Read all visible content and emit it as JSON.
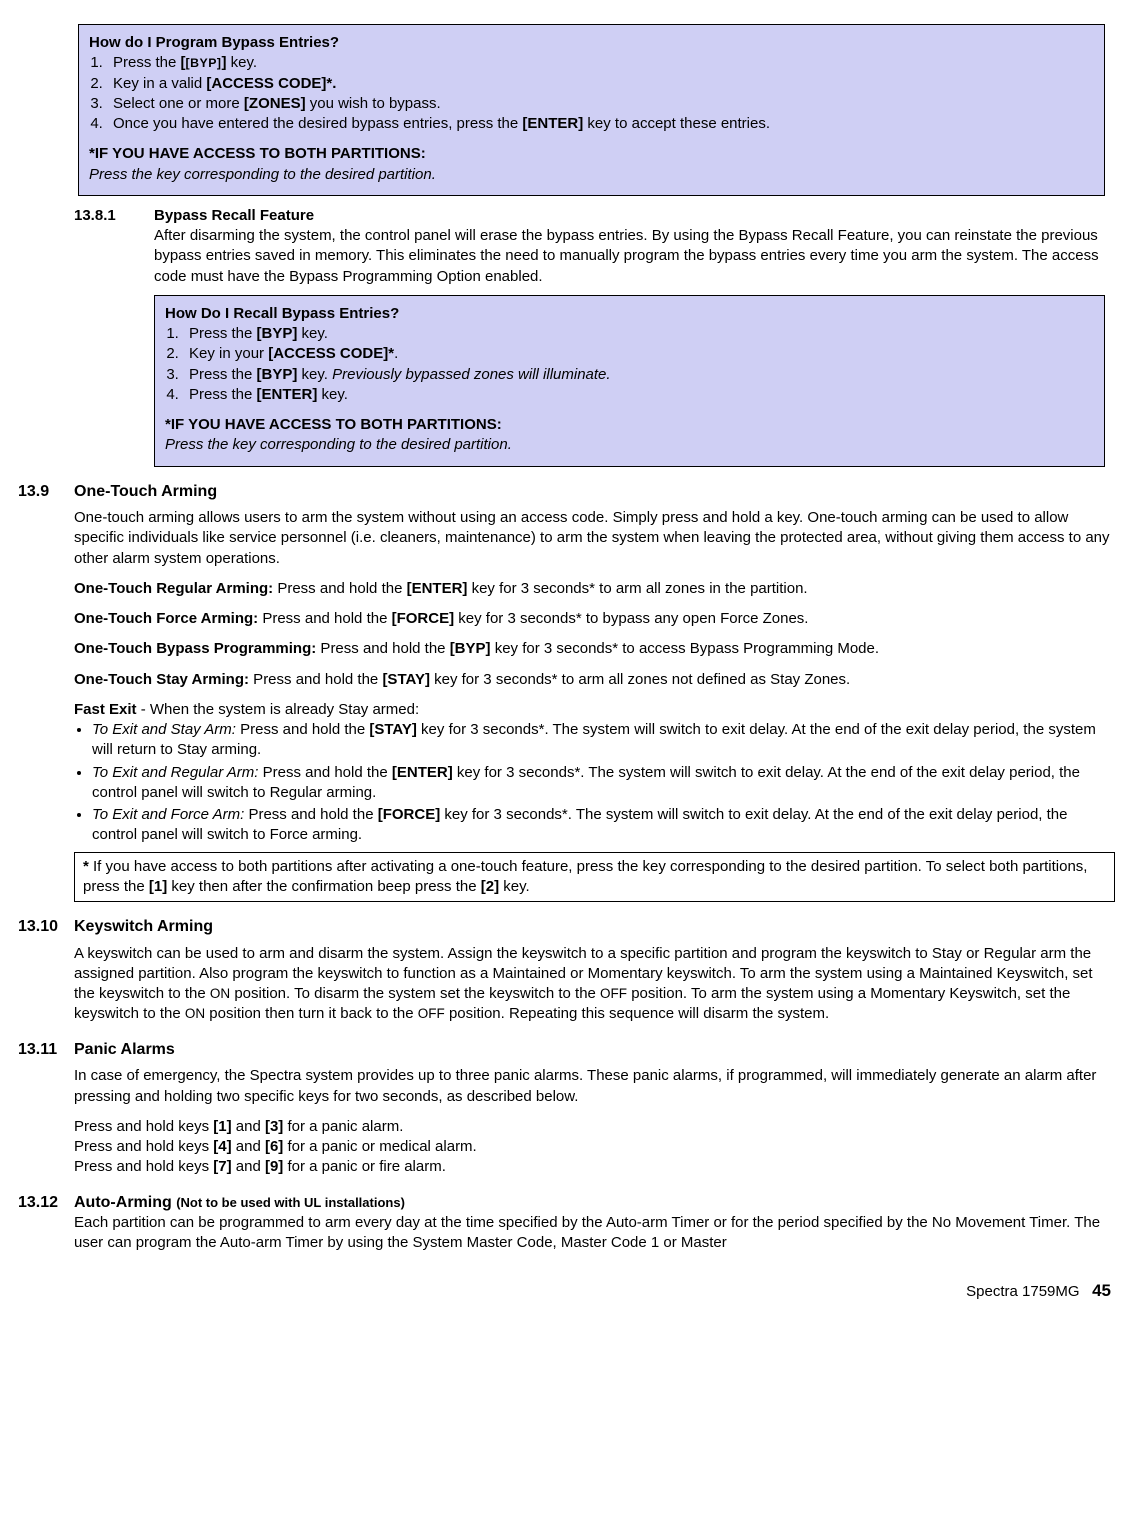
{
  "box1": {
    "title": "How do I Program Bypass Entries?",
    "s1a": "Press the ",
    "s1b": "[BYP]",
    "s1c": " key.",
    "s2a": "Key in a valid ",
    "s2b": "[ACCESS CODE]*.",
    "s3a": "Select one or more ",
    "s3b": "[ZONES]",
    "s3c": " you wish to bypass.",
    "s4a": "Once you have entered the desired bypass entries, press the ",
    "s4b": "[ENTER]",
    "s4c": " key to accept these entries.",
    "noteTitle": "*IF YOU HAVE ACCESS TO BOTH PARTITIONS",
    "noteBody": "Press the key corresponding to the desired partition."
  },
  "sec1381": {
    "num": "13.8.1",
    "title": "Bypass Recall Feature",
    "body": "After disarming the system, the control panel will erase the bypass entries. By using the Bypass Recall Feature, you can reinstate the previous bypass entries saved in memory. This eliminates the need to manually program the bypass entries every time you arm the system. The access code must have the Bypass Programming Option enabled."
  },
  "box2": {
    "title": "How Do I Recall Bypass Entries?",
    "s1a": "Press the ",
    "s1b": "[BYP]",
    "s1c": " key.",
    "s2a": "Key in your ",
    "s2b": "[ACCESS CODE]*",
    "s2c": ".",
    "s3a": "Press the ",
    "s3b": "[BYP]",
    "s3c": " key. ",
    "s3d": "Previously bypassed zones will illuminate.",
    "s4a": "Press the ",
    "s4b": "[ENTER]",
    "s4c": " key.",
    "noteTitle": "*IF YOU HAVE ACCESS TO BOTH PARTITIONS",
    "noteBody": "Press the key corresponding to the desired partition."
  },
  "sec139": {
    "num": "13.9",
    "title": "One-Touch Arming",
    "p1": "One-touch arming allows users to arm the system without using an access code. Simply press and hold a key. One-touch arming can be used to allow specific individuals like service personnel (i.e. cleaners, maintenance) to arm the system when leaving the protected area, without giving them access to any other alarm system operations.",
    "reg_b": "One-Touch Regular Arming:",
    "reg_t1": " Press and hold the ",
    "reg_k": "[ENTER]",
    "reg_t2": " key for 3 seconds* to arm all zones in the partition.",
    "force_b": "One-Touch Force Arming:",
    "force_t1": " Press and hold the ",
    "force_k": "[FORCE]",
    "force_t2": " key for 3 seconds* to bypass any open Force Zones.",
    "byp_b": "One-Touch Bypass Programming:",
    "byp_t1": " Press and hold the ",
    "byp_k": "[BYP]",
    "byp_t2": " key for 3 seconds* to access Bypass Programming Mode.",
    "stay_b": "One-Touch Stay Arming:",
    "stay_t1": " Press and hold the ",
    "stay_k": "[STAY]",
    "stay_t2": " key for 3 seconds* to arm all zones not defined as Stay Zones.",
    "fe_b": "Fast Exit",
    "fe_t": " - When the system is already Stay armed:",
    "li1_a": "To Exit and Stay Arm:",
    "li1_b": " Press and hold the ",
    "li1_k": "[STAY]",
    "li1_c": " key for 3 seconds*. The system will switch to exit delay. At the end of the exit delay period, the system will return to Stay arming.",
    "li2_a": "To Exit and Regular Arm:",
    "li2_b": " Press and hold the ",
    "li2_k": "[ENTER]",
    "li2_c": " key for 3 seconds*. The system will switch to exit delay. At the end of the exit delay period, the control panel will switch to Regular arming.",
    "li3_a": "To Exit and Force Arm:",
    "li3_b": " Press and hold the ",
    "li3_k": "[FORCE]",
    "li3_c": " key for 3 seconds*. The system will switch to exit delay. At the end of the exit delay period, the control panel will switch to Force arming.",
    "noteStar": "*",
    "note_a": " If you have access to both partitions after activating a one-touch feature, press the key corresponding to the desired partition. To select both partitions, press the ",
    "note_k1": "[1]",
    "note_b": " key then after the confirmation beep press the ",
    "note_k2": "[2]",
    "note_c": " key."
  },
  "sec1310": {
    "num": "13.10",
    "title": "Keyswitch Arming",
    "p_a": "A keyswitch can be used to arm and disarm the system. Assign the keyswitch to a specific partition and program the keyswitch to Stay or Regular arm the assigned partition. Also program the keyswitch to function as a Maintained or Momentary keyswitch. To arm the system using a Maintained Keyswitch, set the keyswitch to the ",
    "on1": "ON",
    "p_b": " position. To disarm the system set the keyswitch to the ",
    "off1": "OFF",
    "p_c": " position. To arm the system using a Momentary Keyswitch, set the keyswitch to the ",
    "on2": "ON",
    "p_d": " position then turn it back to the ",
    "off2": "OFF",
    "p_e": " position. Repeating this sequence will disarm the system."
  },
  "sec1311": {
    "num": "13.11",
    "title": "Panic Alarms",
    "p1": "In case of emergency, the Spectra system provides up to three panic alarms. These panic alarms, if programmed, will immediately generate an alarm after pressing and holding two specific keys for two seconds, as described below.",
    "l1a": "Press and hold keys ",
    "l1k1": "[1]",
    "l1b": " and ",
    "l1k2": "[3]",
    "l1c": " for a panic alarm.",
    "l2a": "Press and hold keys ",
    "l2k1": "[4]",
    "l2b": " and ",
    "l2k2": "[6]",
    "l2c": " for a panic or medical alarm.",
    "l3a": "Press and hold keys ",
    "l3k1": "[7]",
    "l3b": " and ",
    "l3k2": "[9]",
    "l3c": " for a panic or fire alarm."
  },
  "sec1312": {
    "num": "13.12",
    "title": "Auto-Arming ",
    "subtitle": "(Not to be used with UL installations)",
    "p1": "Each partition can be programmed to arm every day at the time specified by the Auto-arm Timer or for the period specified by the No Movement Timer. The user can program the Auto-arm Timer by using the System Master Code, Master Code 1 or Master"
  },
  "footer": {
    "model": "Spectra 1759MG",
    "page": "45"
  }
}
